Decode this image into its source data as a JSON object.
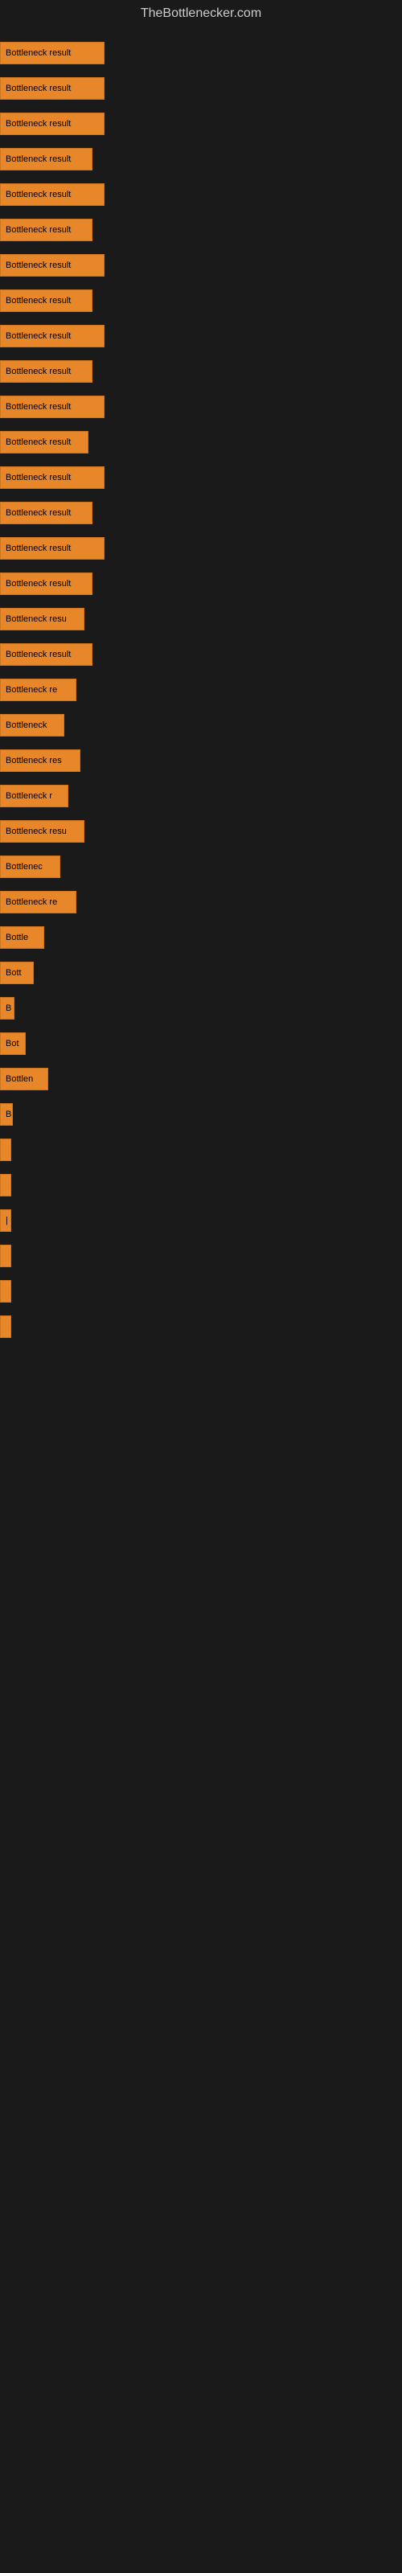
{
  "site": {
    "title": "TheBottlenecker.com"
  },
  "bars": [
    {
      "label": "Bottleneck result",
      "width": 130
    },
    {
      "label": "Bottleneck result",
      "width": 130
    },
    {
      "label": "Bottleneck result",
      "width": 130
    },
    {
      "label": "Bottleneck result",
      "width": 115
    },
    {
      "label": "Bottleneck result",
      "width": 130
    },
    {
      "label": "Bottleneck result",
      "width": 115
    },
    {
      "label": "Bottleneck result",
      "width": 130
    },
    {
      "label": "Bottleneck result",
      "width": 115
    },
    {
      "label": "Bottleneck result",
      "width": 130
    },
    {
      "label": "Bottleneck result",
      "width": 115
    },
    {
      "label": "Bottleneck result",
      "width": 130
    },
    {
      "label": "Bottleneck result",
      "width": 110
    },
    {
      "label": "Bottleneck result",
      "width": 130
    },
    {
      "label": "Bottleneck result",
      "width": 115
    },
    {
      "label": "Bottleneck result",
      "width": 130
    },
    {
      "label": "Bottleneck result",
      "width": 115
    },
    {
      "label": "Bottleneck resu",
      "width": 105
    },
    {
      "label": "Bottleneck result",
      "width": 115
    },
    {
      "label": "Bottleneck re",
      "width": 95
    },
    {
      "label": "Bottleneck",
      "width": 80
    },
    {
      "label": "Bottleneck res",
      "width": 100
    },
    {
      "label": "Bottleneck r",
      "width": 85
    },
    {
      "label": "Bottleneck resu",
      "width": 105
    },
    {
      "label": "Bottlenec",
      "width": 75
    },
    {
      "label": "Bottleneck re",
      "width": 95
    },
    {
      "label": "Bottle",
      "width": 55
    },
    {
      "label": "Bott",
      "width": 42
    },
    {
      "label": "B",
      "width": 18
    },
    {
      "label": "Bot",
      "width": 32
    },
    {
      "label": "Bottlen",
      "width": 60
    },
    {
      "label": "B",
      "width": 16
    },
    {
      "label": "",
      "width": 8
    },
    {
      "label": "",
      "width": 4
    },
    {
      "label": "|",
      "width": 8
    },
    {
      "label": "",
      "width": 6
    },
    {
      "label": "",
      "width": 5
    },
    {
      "label": "",
      "width": 4
    }
  ],
  "colors": {
    "bar_fill": "#e8872a",
    "bar_border": "#cc7720",
    "background": "#1a1a1a",
    "title_text": "#cccccc"
  }
}
